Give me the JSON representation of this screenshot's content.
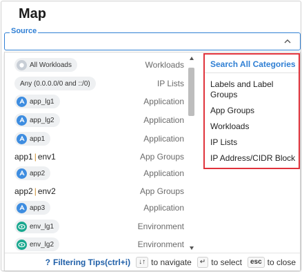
{
  "page": {
    "title": "Map"
  },
  "source": {
    "label": "Source",
    "value": "",
    "placeholder": ""
  },
  "list": [
    {
      "kind": "pill",
      "icon": "workload-icon",
      "text": "All Workloads",
      "category": "Workloads"
    },
    {
      "kind": "pill",
      "icon": "",
      "text": "Any (0.0.0.0/0 and ::/0)",
      "category": "IP Lists"
    },
    {
      "kind": "pill",
      "icon": "application-icon",
      "text": "app_lg1",
      "category": "Application"
    },
    {
      "kind": "pill",
      "icon": "application-icon",
      "text": "app_lg2",
      "category": "Application"
    },
    {
      "kind": "pill",
      "icon": "application-icon",
      "text": "app1",
      "category": "Application"
    },
    {
      "kind": "plain",
      "left": "app1",
      "right": "env1",
      "category": "App Groups"
    },
    {
      "kind": "pill",
      "icon": "application-icon",
      "text": "app2",
      "category": "Application"
    },
    {
      "kind": "plain",
      "left": "app2",
      "right": "env2",
      "category": "App Groups"
    },
    {
      "kind": "pill",
      "icon": "application-icon",
      "text": "app3",
      "category": "Application"
    },
    {
      "kind": "pill",
      "icon": "environment-icon",
      "text": "env_lg1",
      "category": "Environment"
    },
    {
      "kind": "pill",
      "icon": "environment-icon",
      "text": "env_lg2",
      "category": "Environment"
    }
  ],
  "categories": {
    "header": "Search All Categories",
    "items": [
      "Labels and Label Groups",
      "App Groups",
      "Workloads",
      "IP Lists",
      "IP Address/CIDR Block"
    ]
  },
  "footer": {
    "tips_label": "Filtering Tips(ctrl+i)",
    "navigate_key": "↓↑",
    "navigate_label": "to navigate",
    "select_key": "↵",
    "select_label": "to select",
    "close_key": "esc",
    "close_label": "to close"
  },
  "colors": {
    "accent": "#2f7fd4",
    "highlight_border": "#e0313a",
    "app_icon": "#3e8de0",
    "env_icon": "#19a88f"
  }
}
